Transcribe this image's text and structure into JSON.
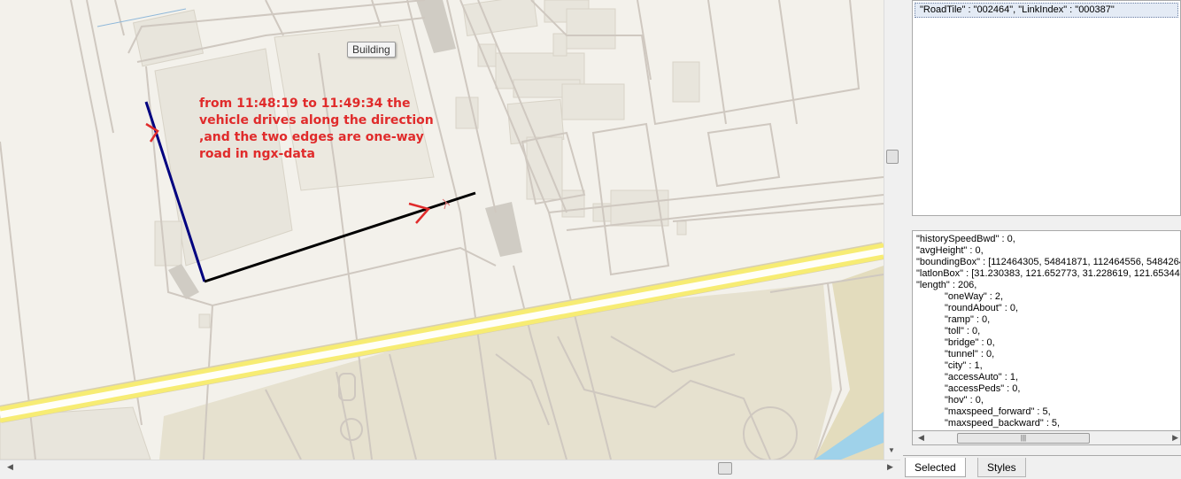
{
  "map": {
    "annotation_lines": [
      "from 11:48:19 to 11:49:34 the",
      "vehicle drives along the direction",
      ",and the two edges are one-way",
      "road in ngx-data"
    ],
    "tooltip": "Building",
    "colors": {
      "background": "#f3f1eb",
      "building": "#e8e5dc",
      "road_outline": "#cfc8c0",
      "highway": "#f7ec73",
      "park": "#e3dcbd",
      "water": "#9fd2ea",
      "edge_primary": "#000080",
      "edge_secondary": "#000000",
      "arrow": "#e02b2b"
    }
  },
  "top_panel": {
    "selected_row": "\"RoadTile\" : \"002464\", \"LinkIndex\" : \"000387\""
  },
  "properties": {
    "lines": [
      "\"historySpeedBwd\" : 0,",
      "\"avgHeight\" : 0,",
      "\"boundingBox\" : [112464305, 54841871, 112464556, 5484264",
      "\"latlonBox\" : [31.230383, 121.652773, 31.228619, 121.65344",
      "\"length\" : 206,"
    ],
    "indented_lines": [
      "\"oneWay\" : 2,",
      "\"roundAbout\" : 0,",
      "\"ramp\" : 0,",
      "\"toll\" : 0,",
      "\"bridge\" : 0,",
      "\"tunnel\" : 0,",
      "\"city\" : 1,",
      "\"accessAuto\" : 1,",
      "\"accessPeds\" : 0,",
      "\"hov\" : 0,",
      "\"maxspeed_forward\" : 5,",
      "\"maxspeed_backward\" : 5,"
    ]
  },
  "tabs": {
    "selected": "Selected",
    "styles": "Styles"
  }
}
